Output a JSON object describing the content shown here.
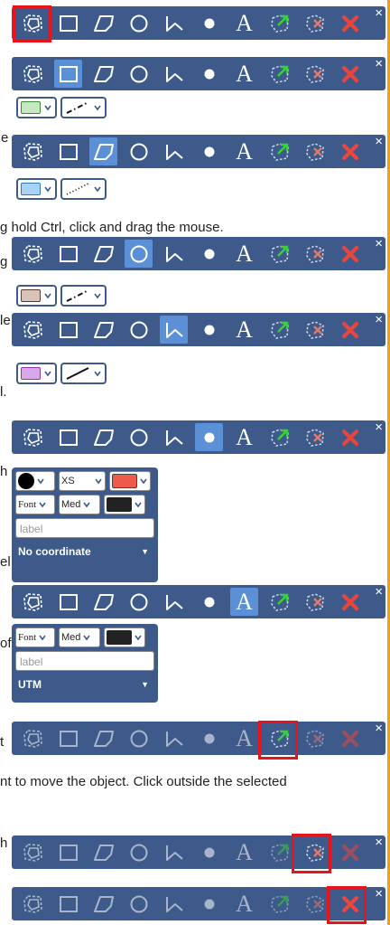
{
  "toolbar": {
    "close_symbol": "×",
    "tools": [
      {
        "id": "polygon-selection",
        "icon": "polygon-dashed-icon"
      },
      {
        "id": "rectangle",
        "icon": "rectangle-icon"
      },
      {
        "id": "polygon",
        "icon": "polygon-icon"
      },
      {
        "id": "circle",
        "icon": "circle-icon"
      },
      {
        "id": "polyline",
        "icon": "polyline-icon"
      },
      {
        "id": "point",
        "icon": "point-icon"
      },
      {
        "id": "text",
        "icon": "text-icon",
        "label": "A"
      },
      {
        "id": "edit",
        "icon": "edit-shape-icon"
      },
      {
        "id": "clear-selection",
        "icon": "delete-shape-icon"
      },
      {
        "id": "delete-all",
        "icon": "close-red-icon"
      }
    ]
  },
  "fragments": {
    "f1": "e",
    "f2": "g hold Ctrl, click and drag the mouse.",
    "f3": "g",
    "f4": "le",
    "f5": "l.",
    "f6": "h",
    "f7": "el",
    "f8": "of",
    "f9": "t",
    "f10": "nt to move the object. Click outside the selected",
    "f11": "h"
  },
  "subtoolbars": {
    "rect": {
      "fill_color": "#c6e8c0",
      "fill_border": "#3a8a3a",
      "line_style": "dash-dot"
    },
    "polygon": {
      "fill_color": "#a9d3f5",
      "fill_border": "#2a77c4",
      "line_style": "dotted"
    },
    "circle": {
      "fill_color": "#d8c3b8",
      "fill_border": "#5a3a30",
      "line_style": "dash-dot"
    },
    "polyline": {
      "fill_color": "#d9a8e8",
      "fill_border": "#8a3aa8",
      "line_style": "solid"
    }
  },
  "point_panel": {
    "size_value": "XS",
    "font_value": "Font",
    "weight_value": "Med",
    "label_placeholder": "label",
    "coordinate_value": "No coordinate",
    "marker_color": "#000000",
    "fill_color": "#f05a4a",
    "text_color": "#222222"
  },
  "text_panel": {
    "font_value": "Font",
    "weight_value": "Med",
    "label_placeholder": "label",
    "coordinate_value": "UTM",
    "text_color": "#222222"
  },
  "dropdown_arrow": "▼"
}
